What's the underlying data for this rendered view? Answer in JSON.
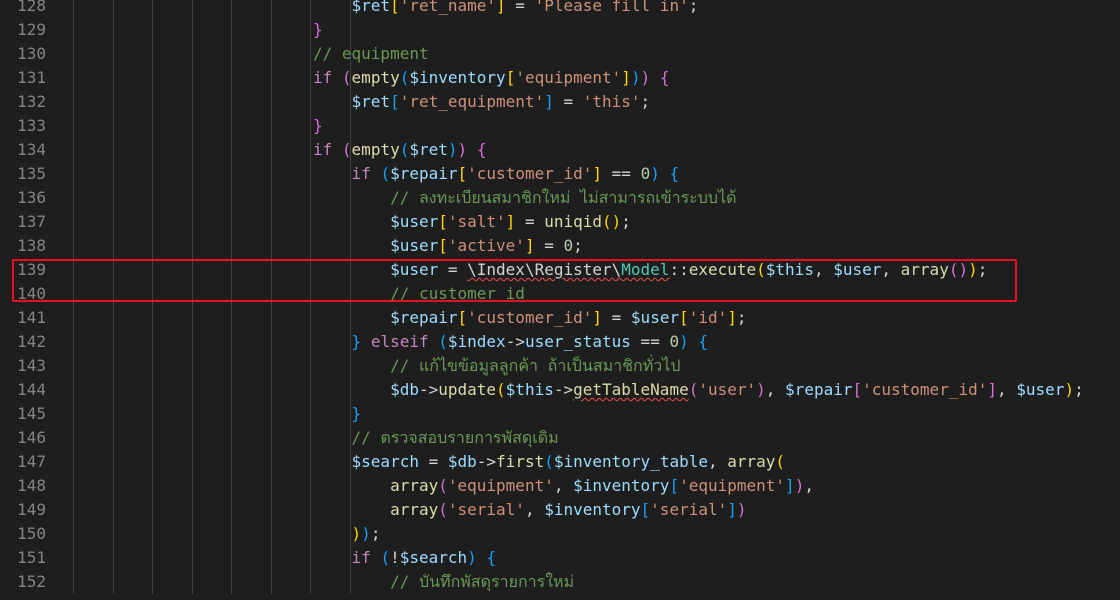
{
  "editor": {
    "highlight_color": "#e81123",
    "lines": [
      {
        "n": "128",
        "indent": 2,
        "segs": [
          [
            "    ",
            ""
          ],
          [
            "$ret",
            "var"
          ],
          [
            "[",
            "br1"
          ],
          [
            "'ret_name'",
            "str"
          ],
          [
            "]",
            "br1"
          ],
          [
            " = ",
            ""
          ],
          [
            "'Please fill in'",
            "str"
          ],
          [
            ";",
            ""
          ]
        ]
      },
      {
        "n": "129",
        "indent": 1,
        "segs": [
          [
            "}",
            "br2"
          ]
        ]
      },
      {
        "n": "130",
        "indent": 1,
        "segs": [
          [
            "// equipment",
            "cmt"
          ]
        ]
      },
      {
        "n": "131",
        "indent": 1,
        "segs": [
          [
            "if",
            "kw"
          ],
          [
            " ",
            ""
          ],
          [
            "(",
            "br2"
          ],
          [
            "empty",
            "fn"
          ],
          [
            "(",
            "br3"
          ],
          [
            "$inventory",
            "var"
          ],
          [
            "[",
            "br1"
          ],
          [
            "'equipment'",
            "str"
          ],
          [
            "]",
            "br1"
          ],
          [
            ")",
            "br3"
          ],
          [
            ")",
            "br2"
          ],
          [
            " ",
            ""
          ],
          [
            "{",
            "br2"
          ]
        ]
      },
      {
        "n": "132",
        "indent": 2,
        "segs": [
          [
            "    ",
            ""
          ],
          [
            "$ret",
            "var"
          ],
          [
            "[",
            "br3"
          ],
          [
            "'ret_equipment'",
            "str"
          ],
          [
            "]",
            "br3"
          ],
          [
            " = ",
            ""
          ],
          [
            "'this'",
            "str"
          ],
          [
            ";",
            ""
          ]
        ]
      },
      {
        "n": "133",
        "indent": 1,
        "segs": [
          [
            "}",
            "br2"
          ]
        ]
      },
      {
        "n": "134",
        "indent": 1,
        "segs": [
          [
            "if",
            "kw"
          ],
          [
            " ",
            ""
          ],
          [
            "(",
            "br2"
          ],
          [
            "empty",
            "fn"
          ],
          [
            "(",
            "br3"
          ],
          [
            "$ret",
            "var"
          ],
          [
            ")",
            "br3"
          ],
          [
            ")",
            "br2"
          ],
          [
            " ",
            ""
          ],
          [
            "{",
            "br2"
          ]
        ]
      },
      {
        "n": "135",
        "indent": 2,
        "segs": [
          [
            "    ",
            ""
          ],
          [
            "if",
            "kw"
          ],
          [
            " ",
            ""
          ],
          [
            "(",
            "br3"
          ],
          [
            "$repair",
            "var"
          ],
          [
            "[",
            "br1"
          ],
          [
            "'customer_id'",
            "str"
          ],
          [
            "]",
            "br1"
          ],
          [
            " == ",
            ""
          ],
          [
            "0",
            "num"
          ],
          [
            ")",
            "br3"
          ],
          [
            " ",
            ""
          ],
          [
            "{",
            "br3"
          ]
        ]
      },
      {
        "n": "136",
        "indent": 3,
        "segs": [
          [
            "        ",
            ""
          ],
          [
            "// ลงทะเบียนสมาชิกใหม่ ไม่สามารถเข้าระบบได้",
            "cmt"
          ]
        ]
      },
      {
        "n": "137",
        "indent": 3,
        "segs": [
          [
            "        ",
            ""
          ],
          [
            "$user",
            "var"
          ],
          [
            "[",
            "br1"
          ],
          [
            "'salt'",
            "str"
          ],
          [
            "]",
            "br1"
          ],
          [
            " = ",
            ""
          ],
          [
            "uniqid",
            "fn"
          ],
          [
            "()",
            "br1"
          ],
          [
            ";",
            ""
          ]
        ]
      },
      {
        "n": "138",
        "indent": 3,
        "segs": [
          [
            "        ",
            ""
          ],
          [
            "$user",
            "var"
          ],
          [
            "[",
            "br1"
          ],
          [
            "'active'",
            "str"
          ],
          [
            "]",
            "br1"
          ],
          [
            " = ",
            ""
          ],
          [
            "0",
            "num"
          ],
          [
            ";",
            ""
          ]
        ]
      },
      {
        "n": "139",
        "indent": 3,
        "segs": [
          [
            "        ",
            ""
          ],
          [
            "$user",
            "var"
          ],
          [
            " = ",
            ""
          ],
          [
            "\\Index\\Register\\",
            "nsq"
          ],
          [
            "Model",
            "clsq"
          ],
          [
            "::",
            ""
          ],
          [
            "execute",
            "fn"
          ],
          [
            "(",
            "br1"
          ],
          [
            "$this",
            "var"
          ],
          [
            ", ",
            ""
          ],
          [
            "$user",
            "var"
          ],
          [
            ", ",
            ""
          ],
          [
            "array",
            "fn"
          ],
          [
            "()",
            "br2"
          ],
          [
            ")",
            "br1"
          ],
          [
            ";",
            ""
          ]
        ]
      },
      {
        "n": "140",
        "indent": 3,
        "segs": [
          [
            "        ",
            ""
          ],
          [
            "// customer id",
            "cmt"
          ]
        ]
      },
      {
        "n": "141",
        "indent": 3,
        "segs": [
          [
            "        ",
            ""
          ],
          [
            "$repair",
            "var"
          ],
          [
            "[",
            "br1"
          ],
          [
            "'customer_id'",
            "str"
          ],
          [
            "]",
            "br1"
          ],
          [
            " = ",
            ""
          ],
          [
            "$user",
            "var"
          ],
          [
            "[",
            "br1"
          ],
          [
            "'id'",
            "str"
          ],
          [
            "]",
            "br1"
          ],
          [
            ";",
            ""
          ]
        ]
      },
      {
        "n": "142",
        "indent": 2,
        "segs": [
          [
            "    ",
            ""
          ],
          [
            "}",
            "br3"
          ],
          [
            " ",
            ""
          ],
          [
            "elseif",
            "kw"
          ],
          [
            " ",
            ""
          ],
          [
            "(",
            "br3"
          ],
          [
            "$index",
            "var"
          ],
          [
            "->",
            ""
          ],
          [
            "user_status",
            "var"
          ],
          [
            " == ",
            ""
          ],
          [
            "0",
            "num"
          ],
          [
            ")",
            "br3"
          ],
          [
            " ",
            ""
          ],
          [
            "{",
            "br3"
          ]
        ]
      },
      {
        "n": "143",
        "indent": 3,
        "segs": [
          [
            "        ",
            ""
          ],
          [
            "// แก้ไขข้อมูลลูกค้า ถ้าเป็นสมาชิกทั่วไป",
            "cmt"
          ]
        ]
      },
      {
        "n": "144",
        "indent": 3,
        "segs": [
          [
            "        ",
            ""
          ],
          [
            "$db",
            "var"
          ],
          [
            "->",
            ""
          ],
          [
            "update",
            "fn"
          ],
          [
            "(",
            "br1"
          ],
          [
            "$this",
            "var"
          ],
          [
            "->",
            ""
          ],
          [
            "getTableName",
            "fnsq"
          ],
          [
            "(",
            "br2"
          ],
          [
            "'user'",
            "str"
          ],
          [
            ")",
            "br2"
          ],
          [
            ", ",
            ""
          ],
          [
            "$repair",
            "var"
          ],
          [
            "[",
            "br2"
          ],
          [
            "'customer_id'",
            "str"
          ],
          [
            "]",
            "br2"
          ],
          [
            ", ",
            ""
          ],
          [
            "$user",
            "var"
          ],
          [
            ")",
            "br1"
          ],
          [
            ";",
            ""
          ]
        ]
      },
      {
        "n": "145",
        "indent": 2,
        "segs": [
          [
            "    ",
            ""
          ],
          [
            "}",
            "br3"
          ]
        ]
      },
      {
        "n": "146",
        "indent": 2,
        "segs": [
          [
            "    ",
            ""
          ],
          [
            "// ตรวจสอบรายการพัสดุเดิม",
            "cmt"
          ]
        ]
      },
      {
        "n": "147",
        "indent": 2,
        "segs": [
          [
            "    ",
            ""
          ],
          [
            "$search",
            "var"
          ],
          [
            " = ",
            ""
          ],
          [
            "$db",
            "var"
          ],
          [
            "->",
            ""
          ],
          [
            "first",
            "fn"
          ],
          [
            "(",
            "br3"
          ],
          [
            "$inventory_table",
            "var"
          ],
          [
            ", ",
            ""
          ],
          [
            "array",
            "fn"
          ],
          [
            "(",
            "br1"
          ]
        ]
      },
      {
        "n": "148",
        "indent": 3,
        "segs": [
          [
            "        ",
            ""
          ],
          [
            "array",
            "fn"
          ],
          [
            "(",
            "br2"
          ],
          [
            "'equipment'",
            "str"
          ],
          [
            ", ",
            ""
          ],
          [
            "$inventory",
            "var"
          ],
          [
            "[",
            "br3"
          ],
          [
            "'equipment'",
            "str"
          ],
          [
            "]",
            "br3"
          ],
          [
            ")",
            "br2"
          ],
          [
            ",",
            ""
          ]
        ]
      },
      {
        "n": "149",
        "indent": 3,
        "segs": [
          [
            "        ",
            ""
          ],
          [
            "array",
            "fn"
          ],
          [
            "(",
            "br2"
          ],
          [
            "'serial'",
            "str"
          ],
          [
            ", ",
            ""
          ],
          [
            "$inventory",
            "var"
          ],
          [
            "[",
            "br3"
          ],
          [
            "'serial'",
            "str"
          ],
          [
            "]",
            "br3"
          ],
          [
            ")",
            "br2"
          ]
        ]
      },
      {
        "n": "150",
        "indent": 2,
        "segs": [
          [
            "    ",
            ""
          ],
          [
            ")",
            "br1"
          ],
          [
            ")",
            "br3"
          ],
          [
            ";",
            ""
          ]
        ]
      },
      {
        "n": "151",
        "indent": 2,
        "segs": [
          [
            "    ",
            ""
          ],
          [
            "if",
            "kw"
          ],
          [
            " ",
            ""
          ],
          [
            "(",
            "br3"
          ],
          [
            "!",
            ""
          ],
          [
            "$search",
            "var"
          ],
          [
            ")",
            "br3"
          ],
          [
            " ",
            ""
          ],
          [
            "{",
            "br3"
          ]
        ]
      },
      {
        "n": "152",
        "indent": 3,
        "segs": [
          [
            "        ",
            ""
          ],
          [
            "// บันทึกพัสดุรายการใหม่",
            "cmt"
          ]
        ]
      }
    ]
  }
}
